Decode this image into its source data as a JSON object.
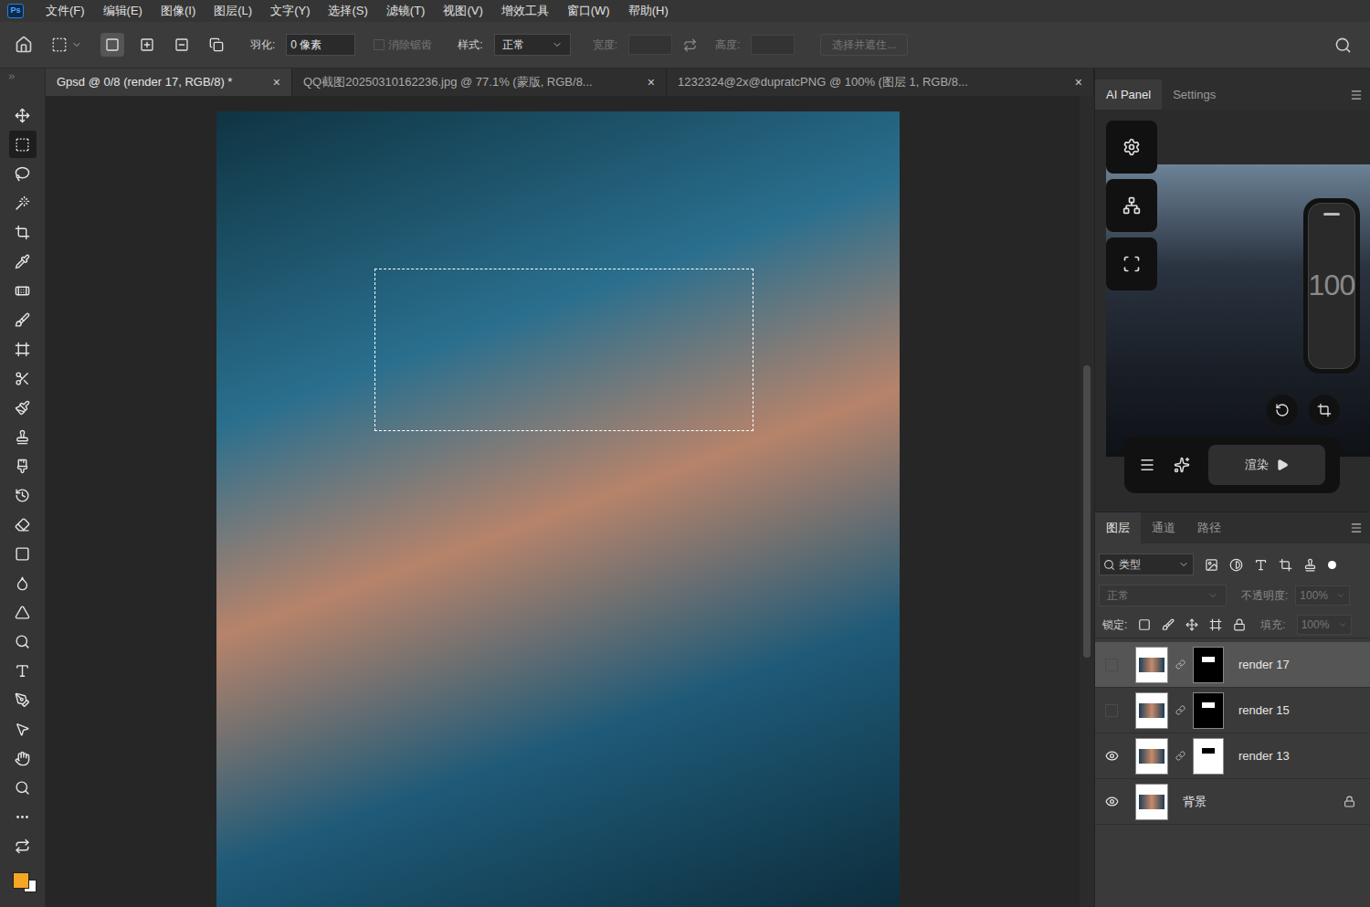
{
  "app": {
    "logo": "Ps"
  },
  "menu": [
    "文件(F)",
    "编辑(E)",
    "图像(I)",
    "图层(L)",
    "文字(Y)",
    "选择(S)",
    "滤镜(T)",
    "视图(V)",
    "增效工具",
    "窗口(W)",
    "帮助(H)"
  ],
  "options": {
    "selection_modes": [
      {
        "selected": true
      },
      {
        "selected": false
      },
      {
        "selected": false
      },
      {
        "selected": false
      }
    ],
    "feather_label": "羽化:",
    "feather_value": "0 像素",
    "antialias": {
      "label": "消除锯齿",
      "checked": false,
      "disabled": true
    },
    "style_label": "样式:",
    "style_value": "正常",
    "width_label": "宽度:",
    "height_label": "高度:",
    "select_mask": "选择并遮住..."
  },
  "doc_tabs": [
    {
      "label": "Gpsd @ 0/8 (render 17, RGB/8) *",
      "selected": true,
      "close": "×"
    },
    {
      "label": "QQ截图20250310162236.jpg @ 77.1% (蒙版, RGB/8...",
      "selected": false,
      "close": "×"
    },
    {
      "label": "1232324@2x@dupratcPNG @ 100% (图层 1, RGB/8...",
      "selected": false,
      "close": "×"
    }
  ],
  "tools": [
    {
      "selected": false
    },
    {
      "selected": true
    },
    {
      "selected": false
    },
    {
      "selected": false
    },
    {
      "selected": false
    },
    {
      "selected": false
    },
    {
      "selected": false
    },
    {
      "selected": false
    },
    {
      "selected": false
    },
    {
      "selected": false
    },
    {
      "selected": false
    },
    {
      "selected": false
    },
    {
      "selected": false
    },
    {
      "selected": false
    },
    {
      "selected": false
    },
    {
      "selected": false
    },
    {
      "selected": false
    },
    {
      "selected": false
    },
    {
      "selected": false
    },
    {
      "selected": false
    },
    {
      "selected": false
    },
    {
      "selected": false
    },
    {
      "selected": false
    },
    {
      "selected": false
    },
    {
      "selected": false
    },
    {
      "selected": false
    }
  ],
  "ai_panel": {
    "tabs": [
      {
        "label": "AI Panel",
        "selected": true
      },
      {
        "label": "Settings",
        "selected": false
      }
    ],
    "slider_reading": "100",
    "render_button": "渲染"
  },
  "layers_panel": {
    "tabs": [
      {
        "label": "图层",
        "selected": true
      },
      {
        "label": "通道",
        "selected": false
      },
      {
        "label": "路径",
        "selected": false
      }
    ],
    "filter": "类型",
    "blend_mode": "正常",
    "opacity_label": "不透明度:",
    "opacity_value": "100%",
    "lock_label": "锁定:",
    "fill_label": "填充:",
    "fill_value": "100%",
    "layers": [
      {
        "name": "render 17",
        "visible": false,
        "selected": true,
        "locked": false,
        "mask": true
      },
      {
        "name": "render 15",
        "visible": false,
        "selected": false,
        "locked": false,
        "mask": true
      },
      {
        "name": "render 13",
        "visible": true,
        "selected": false,
        "locked": false,
        "mask": true
      },
      {
        "name": "背景",
        "visible": true,
        "selected": false,
        "locked": true,
        "mask": false
      }
    ]
  }
}
